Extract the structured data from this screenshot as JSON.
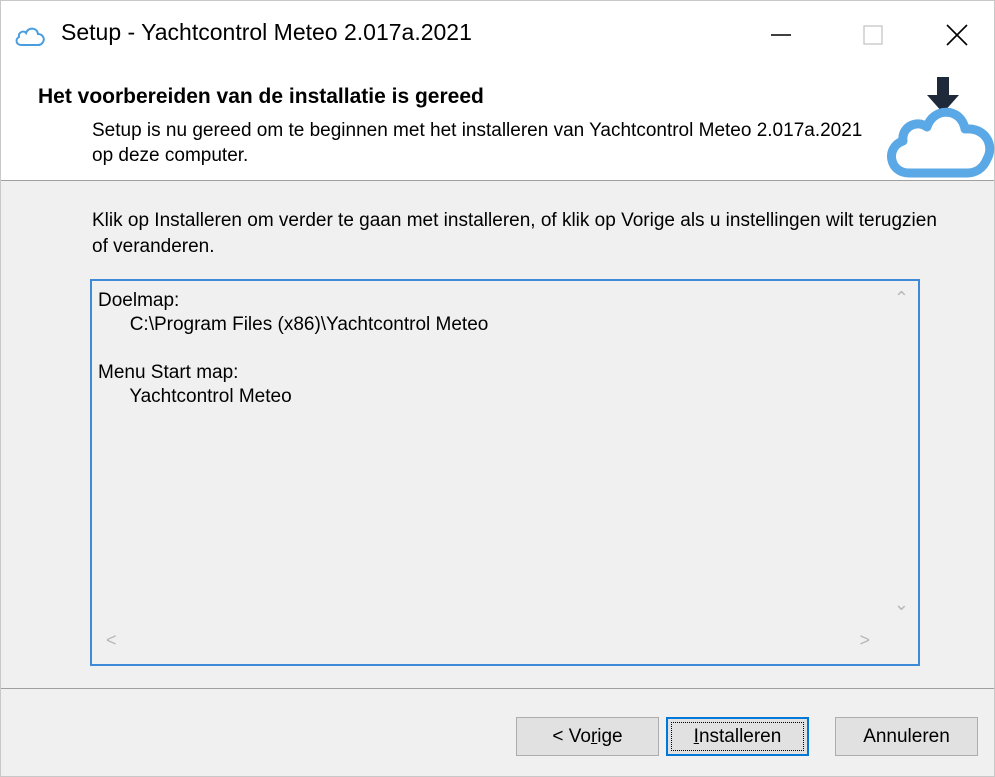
{
  "window": {
    "title": "Setup - Yachtcontrol Meteo 2.017a.2021",
    "icon": "cloud-icon"
  },
  "titlebar_buttons": {
    "minimize_icon": "minimize-icon",
    "maximize_icon": "maximize-icon",
    "close_icon": "close-icon"
  },
  "header": {
    "title": "Het voorbereiden van de installatie is gereed",
    "description": "Setup is nu gereed om te beginnen met het installeren van Yachtcontrol Meteo 2.017a.2021 op deze computer.",
    "logo_icon": "cloud-download-icon"
  },
  "main": {
    "intro": "Klik op Installeren om verder te gaan met installeren, of klik op Vorige als u instellingen wilt terugzien of veranderen.",
    "memo": {
      "sections": [
        {
          "heading": "Doelmap:",
          "value": "C:\\Program Files (x86)\\Yachtcontrol Meteo"
        },
        {
          "heading": "Menu Start map:",
          "value": "Yachtcontrol Meteo"
        }
      ]
    }
  },
  "buttons": {
    "back": {
      "pre": "< Vo",
      "accel": "r",
      "post": "ige"
    },
    "install": {
      "pre": "",
      "accel": "I",
      "post": "nstalleren"
    },
    "cancel": {
      "label": "Annuleren"
    }
  },
  "colors": {
    "accent": "#0078d7",
    "memo_border": "#3c8ad8",
    "logo_blue": "#5aa9e6",
    "background": "#f0f0f0"
  }
}
